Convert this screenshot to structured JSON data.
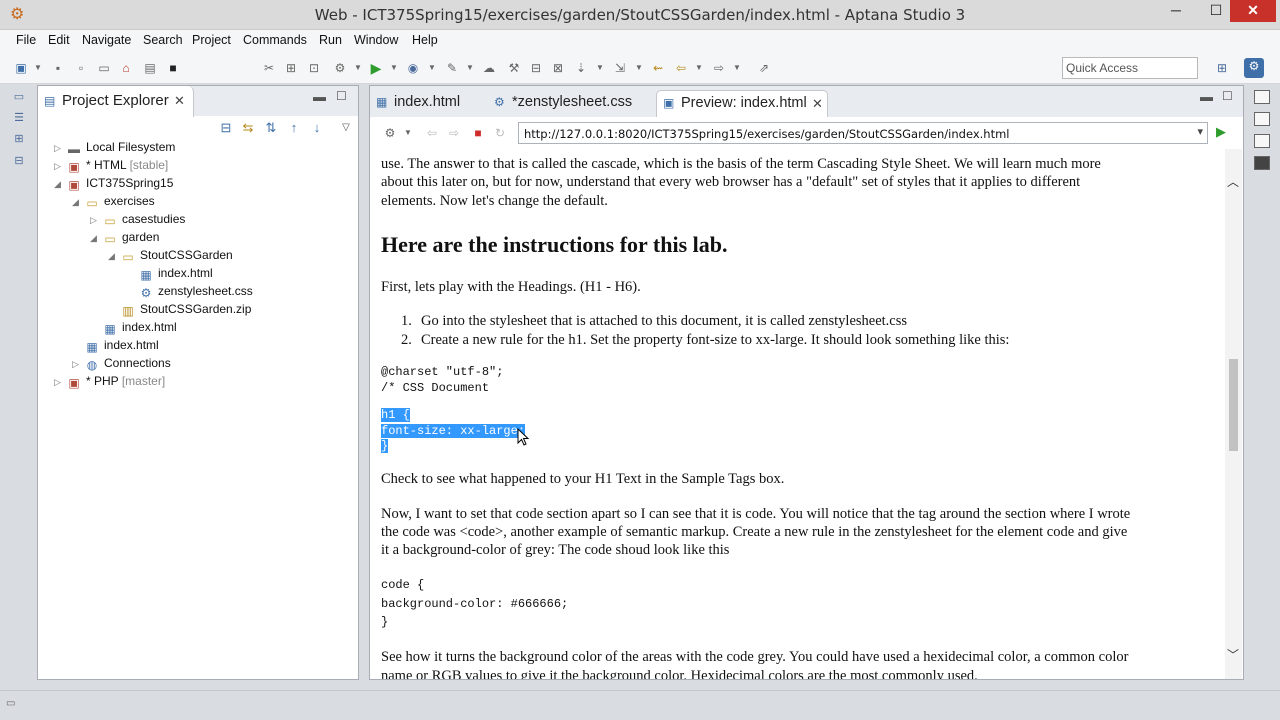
{
  "window": {
    "title": "Web - ICT375Spring15/exercises/garden/StoutCSSGarden/index.html - Aptana Studio 3",
    "min_label": "─",
    "max_label": "☐",
    "close_label": "✕"
  },
  "menu": [
    "File",
    "Edit",
    "Navigate",
    "Search",
    "Project",
    "Commands",
    "Run",
    "Window",
    "Help"
  ],
  "toolbar": {
    "quick_access_placeholder": "Quick Access"
  },
  "project_explorer": {
    "title": "Project Explorer",
    "tree": [
      {
        "label": "Local Filesystem",
        "sub": "",
        "twisty": "▷",
        "icon": "drive-icon"
      },
      {
        "label": "* HTML",
        "sub": "[stable]",
        "twisty": "▷",
        "icon": "project-icon"
      },
      {
        "label": "ICT375Spring15",
        "sub": "",
        "twisty": "◢",
        "icon": "project-icon"
      },
      {
        "label": "exercises",
        "sub": "",
        "twisty": "◢",
        "icon": "folder-icon"
      },
      {
        "label": "casestudies",
        "sub": "",
        "twisty": "▷",
        "icon": "folder-icon"
      },
      {
        "label": "garden",
        "sub": "",
        "twisty": "◢",
        "icon": "folder-icon"
      },
      {
        "label": "StoutCSSGarden",
        "sub": "",
        "twisty": "◢",
        "icon": "folder-icon"
      },
      {
        "label": "index.html",
        "sub": "",
        "twisty": "",
        "icon": "html-file-icon"
      },
      {
        "label": "zenstylesheet.css",
        "sub": "",
        "twisty": "",
        "icon": "css-file-icon"
      },
      {
        "label": "StoutCSSGarden.zip",
        "sub": "",
        "twisty": "",
        "icon": "zip-file-icon"
      },
      {
        "label": "index.html",
        "sub": "",
        "twisty": "",
        "icon": "html-file-icon"
      },
      {
        "label": "index.html",
        "sub": "",
        "twisty": "",
        "icon": "html-file-icon"
      },
      {
        "label": "Connections",
        "sub": "",
        "twisty": "▷",
        "icon": "globe-icon"
      },
      {
        "label": "* PHP",
        "sub": "[master]",
        "twisty": "▷",
        "icon": "project-icon"
      }
    ]
  },
  "editor": {
    "tabs": [
      {
        "label": "index.html",
        "active": false
      },
      {
        "label": "*zenstylesheet.css",
        "active": false
      },
      {
        "label": "Preview: index.html",
        "active": true
      }
    ],
    "url": "http://127.0.0.1:8020/ICT375Spring15/exercises/garden/StoutCSSGarden/index.html"
  },
  "preview": {
    "para_top_1": "use. The answer to that is called the cascade, which is the basis of the term Cascading Style Sheet. We will learn much more",
    "para_top_2": "about this later on, but for now, understand that every web browser has a \"default\" set of styles that it applies to different",
    "para_top_3": "elements. Now let's change the default.",
    "heading": "Here are the instructions for this lab.",
    "first_line": "First, lets play with the Headings. (H1 - H6).",
    "list": [
      {
        "num": "1.",
        "text": "Go into the stylesheet that is attached to this document, it is called zenstylesheet.css"
      },
      {
        "num": "2.",
        "text": "Create a new rule for the h1. Set the property font-size to xx-large. It should look something like this:"
      }
    ],
    "code1_line1": "@charset \"utf-8\";",
    "code1_line2": "/* CSS Document",
    "code_sel_1": "h1 {",
    "code_sel_2": "font-size: xx-large;",
    "code_sel_3": "}",
    "check_line": "Check to see what happened to your H1 Text in the Sample Tags box.",
    "now_1": "Now, I want to set that code section apart so I can see that it is code. You will notice that the tag around the section where I wrote",
    "now_2": "the code was <code>, another example of semantic markup. Create a new rule in the zenstylesheet for the element code and give",
    "now_3": "it a background-color of grey: The code shoud look like this",
    "code2_1": "code {",
    "code2_2": "background-color: #666666;",
    "code2_3": "}",
    "see_1": "See how it turns the background color of the areas with the code grey. You could have used a hexidecimal color, a common color",
    "see_2": "name or RGB values to give it the background color. Hexidecimal colors are the most commonly used."
  }
}
